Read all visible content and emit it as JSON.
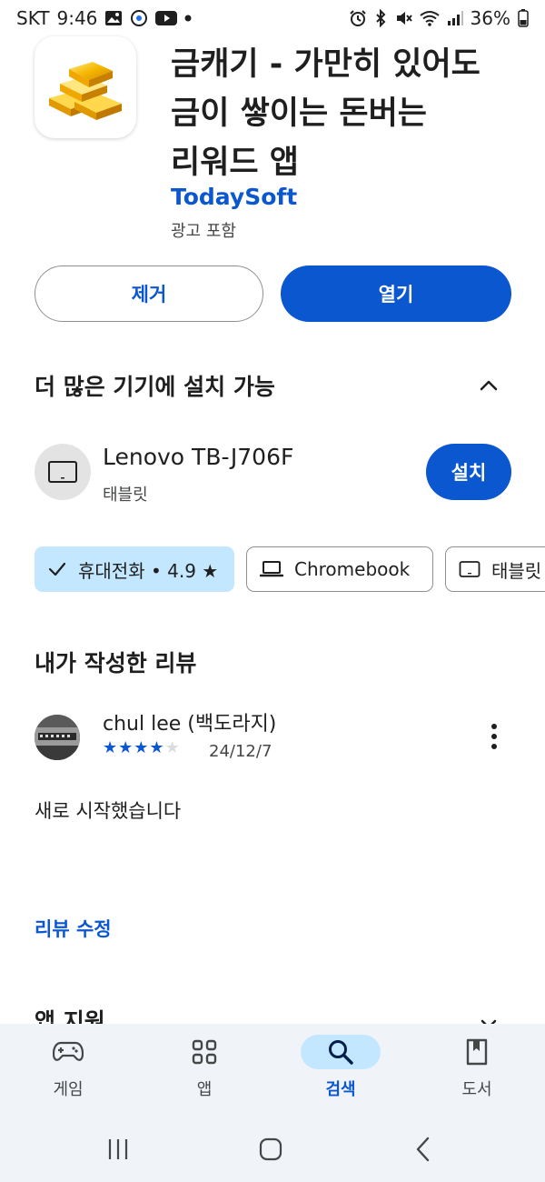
{
  "status_bar": {
    "carrier": "SKT",
    "time": "9:46",
    "battery": "36%",
    "left_icons": [
      "gallery-icon",
      "notification-app-icon",
      "youtube-icon",
      "dot-icon"
    ],
    "right_icons": [
      "alarm-icon",
      "bluetooth-icon",
      "mute-icon",
      "wifi-icon",
      "signal-icon",
      "battery-icon"
    ]
  },
  "app": {
    "title": "금캐기 - 가만히 있어도\n금이 쌓이는 돈버는\n리워드 앱",
    "developer": "TodaySoft",
    "ads_note": "광고 포함",
    "icon": "gold-bars-icon"
  },
  "actions": {
    "uninstall_label": "제거",
    "open_label": "열기"
  },
  "more_devices": {
    "title": "더 많은 기기에 설치 가능",
    "device_name": "Lenovo TB-J706F",
    "device_type": "태블릿",
    "install_label": "설치",
    "chips": [
      {
        "label": "휴대전화 • 4.9 ★",
        "icon": "check-icon",
        "selected": true
      },
      {
        "label": "Chromebook",
        "icon": "laptop-icon",
        "selected": false
      },
      {
        "label": "태블릿",
        "icon": "tablet-icon",
        "selected": false
      }
    ]
  },
  "my_review": {
    "title": "내가 작성한 리뷰",
    "reviewer": "chul lee (백도라지)",
    "rating": 4,
    "max_rating": 5,
    "date": "24/12/7",
    "text": "새로 시작했습니다",
    "edit_label": "리뷰 수정"
  },
  "next_section": {
    "title": "앱 지원"
  },
  "bottom_nav": {
    "items": [
      {
        "label": "게임",
        "icon": "gamepad-icon",
        "active": false
      },
      {
        "label": "앱",
        "icon": "apps-grid-icon",
        "active": false
      },
      {
        "label": "검색",
        "icon": "search-icon",
        "active": true
      },
      {
        "label": "도서",
        "icon": "book-icon",
        "active": false
      }
    ]
  },
  "colors": {
    "accent": "#0b57d0",
    "chip_selected": "#c2e7ff",
    "nav_bg": "#f0f4f9",
    "star": "#0b57d0"
  }
}
